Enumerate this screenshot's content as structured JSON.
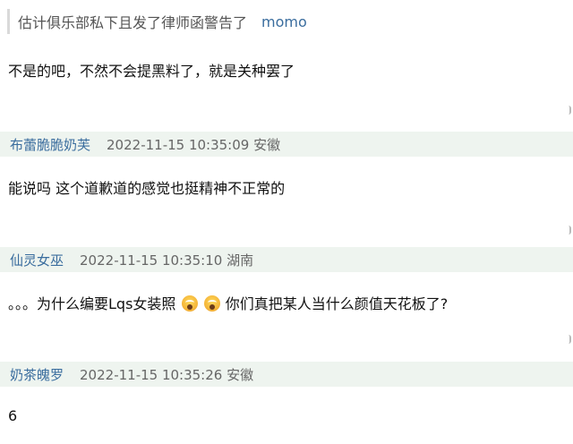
{
  "quote": {
    "text": "估计俱乐部私下且发了律师函警告了",
    "author": "momo"
  },
  "reply_main": {
    "text": "不是的吧，不然不会提黑料了，就是关种罢了"
  },
  "comments": [
    {
      "user": "布蕾脆脆奶芙",
      "time_location": "2022-11-15 10:35:09 安徽",
      "text": "能说吗 这个道歉道的感觉也挺精神不正常的"
    },
    {
      "user": "仙灵女巫",
      "time_location": "2022-11-15 10:35:10 湖南",
      "text_parts": [
        "。。。为什么编要Lqs女装照",
        "你们真把某人当什么颜值天花板了?"
      ],
      "emoji": [
        "scared-face-icon",
        "scared-face-icon"
      ]
    },
    {
      "user": "奶茶魄罗",
      "time_location": "2022-11-15 10:35:26 安徽",
      "text": "6"
    }
  ]
}
